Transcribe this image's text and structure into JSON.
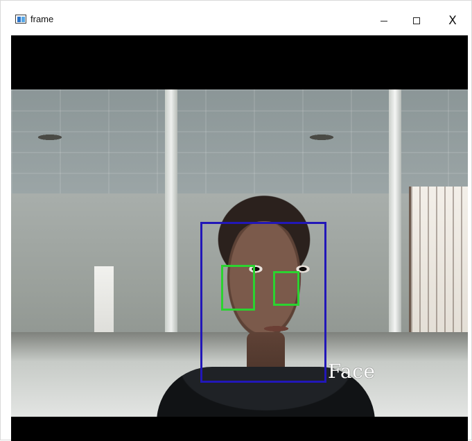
{
  "window": {
    "title": "frame",
    "controls": {
      "minimize_icon": "minimize-icon",
      "maximize_icon": "maximize-icon",
      "close_icon": "close-icon",
      "close_glyph": "X"
    }
  },
  "overlay": {
    "face_label": "Face",
    "face_box_color": "#2217b8",
    "eye_box_color": "#2bd330"
  },
  "icons": {
    "app_icon": "app-window-icon"
  }
}
